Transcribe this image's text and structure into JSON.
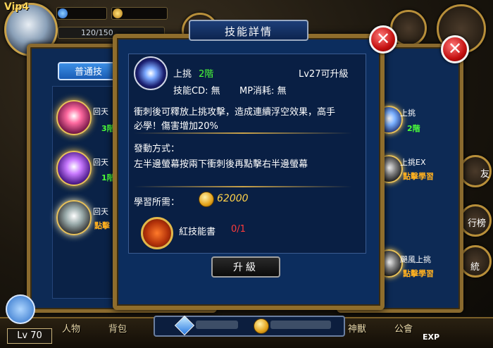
{
  "hud": {
    "vip": "Vip4",
    "hp_text": "120/150",
    "level_label": "Lv 70",
    "exp_label": "EXP"
  },
  "left_panel": {
    "tab_normal": "普通技",
    "skills": [
      {
        "name": "回天",
        "level": "3階"
      },
      {
        "name": "回天",
        "level": "1階"
      },
      {
        "name": "回天",
        "action": "點擊"
      }
    ]
  },
  "right_panel": {
    "skills": [
      {
        "name": "上挑",
        "level": "2階"
      },
      {
        "name": "上挑EX",
        "action": "點擊學習"
      },
      {
        "name": "颶風上挑",
        "action": "點擊學習"
      }
    ]
  },
  "side_labels": {
    "friends": "友",
    "rank": "行榜",
    "system": "統"
  },
  "detail": {
    "title": "技能詳情",
    "skill_name": "上挑",
    "skill_level": "2階",
    "upgrade_hint": "Lv27可升級",
    "cd_label": "技能CD: 無",
    "mp_label": "MP消耗: 無",
    "description_line1": "衝刺後可釋放上挑攻擊，造成連續浮空效果，高手",
    "description_line2": "必學！傷害增加20%",
    "trigger_title": "發動方式：",
    "trigger_text": "左半邊螢幕按兩下衝刺後再點擊右半邊螢幕",
    "learn_label": "學習所需：",
    "coin_cost": "62000",
    "item_name": "紅技能書",
    "item_count": "0/1",
    "upgrade_button": "升級"
  },
  "bottom_menu": {
    "item1": "人物",
    "item2": "背包",
    "item3": "神獸",
    "item4": "公會"
  },
  "colors": {
    "panel_blue": "#0c2d5e",
    "gold_border": "#8f6d2c",
    "level_green": "#4cff3a",
    "warning_red": "#ff3b3b",
    "coin_gold": "#ffd24a"
  }
}
